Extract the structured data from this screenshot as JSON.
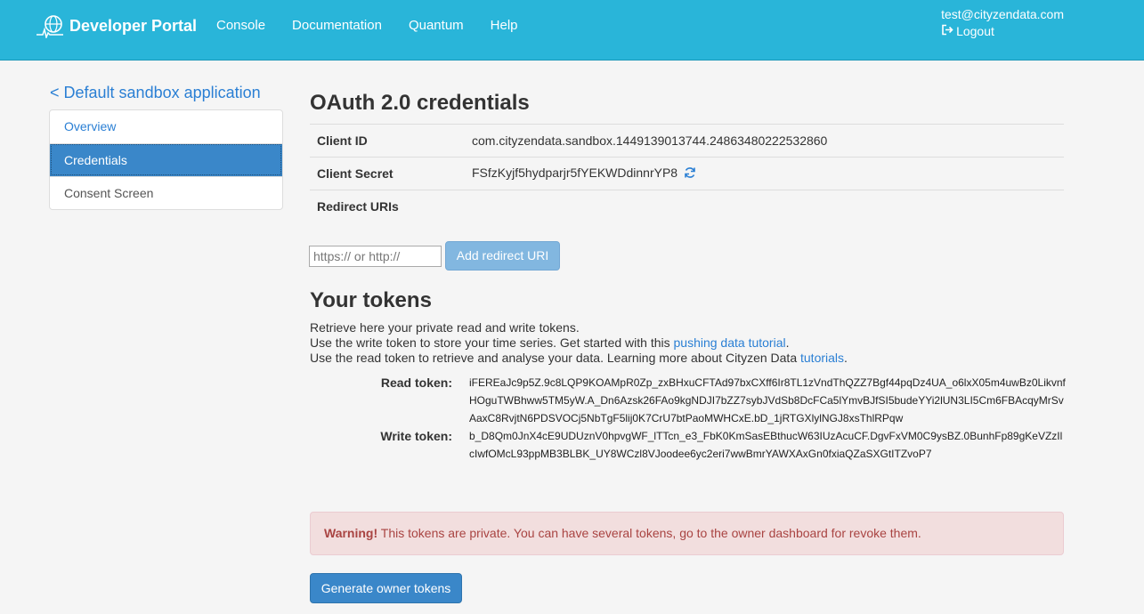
{
  "navbar": {
    "brand": "Developer Portal",
    "brand_icon": "globe-pulse-logo-icon",
    "links": [
      "Console",
      "Documentation",
      "Quantum",
      "Help"
    ],
    "user_email": "test@cityzendata.com",
    "logout_label": "Logout",
    "logout_icon": "sign-out-icon",
    "color": "#29b5d9"
  },
  "sidebar": {
    "back_link": "< Default sandbox application",
    "items": [
      {
        "label": "Overview",
        "active": false
      },
      {
        "label": "Credentials",
        "active": true
      },
      {
        "label": "Consent Screen",
        "active": false
      }
    ]
  },
  "credentials": {
    "title": "OAuth 2.0 credentials",
    "rows": [
      {
        "key": "Client ID",
        "value": "com.cityzendata.sandbox.1449139013744.24863480222532860"
      },
      {
        "key": "Client Secret",
        "value": "FSfzKyjf5hydparjr5fYEKWDdinnrYP8"
      },
      {
        "key": "Redirect URIs",
        "value": ""
      }
    ],
    "refresh_icon": "refresh-icon",
    "redirect_input_placeholder": "https:// or http://",
    "add_redirect_label": "Add redirect URI"
  },
  "tokens": {
    "title": "Your tokens",
    "line1": "Retrieve here your private read and write tokens.",
    "line2_prefix": "Use the write token to store your time series. Get started with this ",
    "line2_link": "pushing data tutorial",
    "line2_suffix": ".",
    "line3_prefix": "Use the read token to retrieve and analyse your data. Learning more about Cityzen Data ",
    "line3_link": "tutorials",
    "line3_suffix": ".",
    "read_label": "Read token:",
    "read_value": "iFEREaJc9p5Z.9c8LQP9KOAMpR0Zp_zxBHxuCFTAd97bxCXff6Ir8TL1zVndThQZZ7Bgf44pqDz4UA_o6lxX05m4uwBz0LikvnfHOguTWBhww5TM5yW.A_Dn6Azsk26FAo9kgNDJI7bZZ7sybJVdSb8DcFCa5lYmvBJfSI5budeYYi2lUN3LI5Cm6FBAcqyMrSvAaxC8RvjtN6PDSVOCj5NbTgF5lij0K7CrU7btPaoMWHCxE.bD_1jRTGXlylNGJ8xsThlRPqw",
    "write_label": "Write token:",
    "write_value": "b_D8Qm0JnX4cE9UDUznV0hpvgWF_lTTcn_e3_FbK0KmSasEBthucW63IUzAcuCF.DgvFxVM0C9ysBZ.0BunhFp89gKeVZzIlcIwfOMcL93ppMB3BLBK_UY8WCzl8VJoodee6yc2eri7wwBmrYAWXAxGn0fxiaQZaSXGtITZvoP7"
  },
  "warning": {
    "strong": "Warning!",
    "text": " This tokens are private. You can have several tokens, go to the owner dashboard for revoke them."
  },
  "generate_button": "Generate owner tokens",
  "colors": {
    "primary": "#3a87c9",
    "link": "#2a7fd4",
    "warning_bg": "#f2dede",
    "warning_text": "#a94442"
  }
}
